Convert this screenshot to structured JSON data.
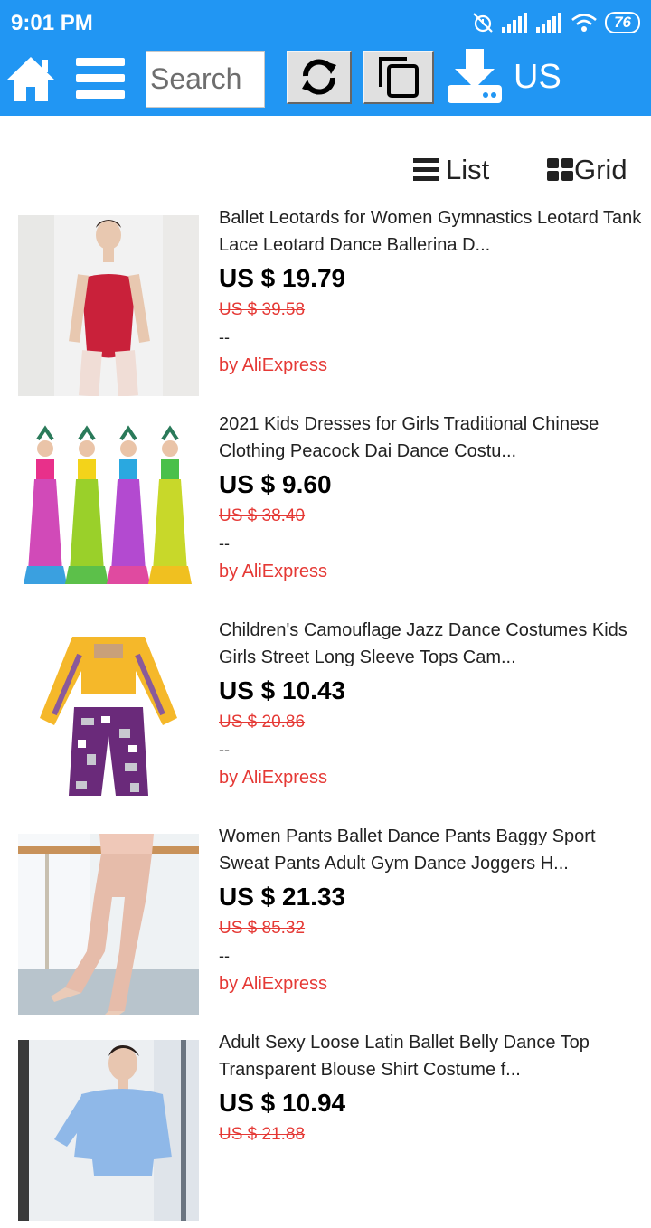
{
  "status_bar": {
    "time": "9:01 PM",
    "battery": "76"
  },
  "toolbar": {
    "search_placeholder": "Search",
    "region": "US"
  },
  "view_toggle": {
    "list_label": "List",
    "grid_label": "Grid"
  },
  "products": [
    {
      "title": "Ballet Leotards for Women Gymnastics Leotard Tank Lace Leotard Dance Ballerina D...",
      "price": "US $ 19.79",
      "original_price": "US $ 39.58",
      "extra": "--",
      "seller": "by AliExpress"
    },
    {
      "title": "2021 Kids Dresses for Girls Traditional Chinese Clothing Peacock Dai Dance Costu...",
      "price": "US $ 9.60",
      "original_price": "US $ 38.40",
      "extra": "--",
      "seller": "by AliExpress"
    },
    {
      "title": "Children's Camouflage Jazz Dance Costumes Kids Girls Street Long Sleeve Tops Cam...",
      "price": "US $ 10.43",
      "original_price": "US $ 20.86",
      "extra": "--",
      "seller": "by AliExpress"
    },
    {
      "title": "Women Pants Ballet Dance Pants Baggy Sport Sweat Pants Adult Gym Dance Joggers H...",
      "price": "US $ 21.33",
      "original_price": "US $ 85.32",
      "extra": "--",
      "seller": "by AliExpress"
    },
    {
      "title": "Adult Sexy Loose Latin Ballet Belly Dance Top Transparent Blouse Shirt Costume f...",
      "price": "US $ 10.94",
      "original_price": "US $ 21.88",
      "extra": "",
      "seller": ""
    }
  ],
  "colors": {
    "accent": "#2196f3",
    "price_red": "#e53935"
  },
  "icons": [
    "home-icon",
    "menu-icon",
    "refresh-icon",
    "copy-icon",
    "download-icon",
    "list-icon",
    "grid-icon"
  ]
}
